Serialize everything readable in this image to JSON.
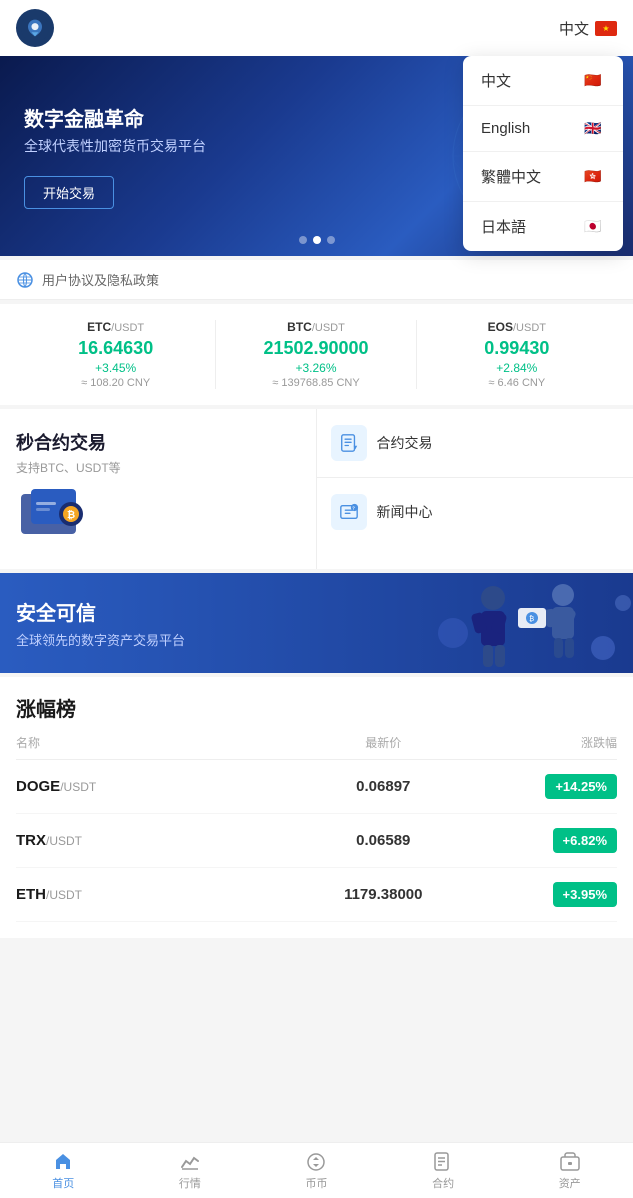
{
  "header": {
    "lang_label": "中文",
    "logo_alt": "DragonEx Logo"
  },
  "lang_dropdown": {
    "options": [
      {
        "label": "中文",
        "flag": "🇨🇳",
        "active": true
      },
      {
        "label": "English",
        "flag": "🇬🇧",
        "active": false
      },
      {
        "label": "繁體中文",
        "flag": "🇭🇰",
        "active": false
      },
      {
        "label": "日本語",
        "flag": "🇯🇵",
        "active": false
      }
    ]
  },
  "banner": {
    "line1": "数字金融革命",
    "line2": "全球代表性加密货币交易平台",
    "cta_label": "开始交易",
    "dots": 3,
    "active_dot": 1
  },
  "notice": {
    "text": "用户协议及隐私政策"
  },
  "prices": [
    {
      "pair_bold": "ETC",
      "pair_rest": "/USDT",
      "value": "16.64630",
      "change": "+3.45%",
      "cny": "≈ 108.20 CNY"
    },
    {
      "pair_bold": "BTC",
      "pair_rest": "/USDT",
      "value": "21502.90000",
      "change": "+3.26%",
      "cny": "≈ 139768.85 CNY"
    },
    {
      "pair_bold": "EOS",
      "pair_rest": "/USDT",
      "value": "0.99430",
      "change": "+2.84%",
      "cny": "≈ 6.46 CNY"
    }
  ],
  "features": {
    "left_title": "秒合约交易",
    "left_sub": "支持BTC、USDT等",
    "right_items": [
      {
        "label": "合约交易",
        "icon": "contract"
      },
      {
        "label": "新闻中心",
        "icon": "news"
      }
    ]
  },
  "blue_banner": {
    "title": "安全可信",
    "subtitle": "全球领先的数字资产交易平台"
  },
  "gainers": {
    "title": "涨幅榜",
    "headers": [
      "名称",
      "最新价",
      "涨跌幅"
    ],
    "rows": [
      {
        "coin": "DOGE",
        "pair": "/USDT",
        "price": "0.06897",
        "change": "+14.25%",
        "color": "#00c087"
      },
      {
        "coin": "TRX",
        "pair": "/USDT",
        "price": "0.06589",
        "change": "+6.82%",
        "color": "#00c087"
      },
      {
        "coin": "ETH",
        "pair": "/USDT",
        "price": "1179.38000",
        "change": "+3.95%",
        "color": "#00c087"
      }
    ]
  },
  "bottom_nav": {
    "items": [
      {
        "label": "首页",
        "active": true
      },
      {
        "label": "行情",
        "active": false
      },
      {
        "label": "币币",
        "active": false
      },
      {
        "label": "合约",
        "active": false
      },
      {
        "label": "资产",
        "active": false
      }
    ]
  }
}
